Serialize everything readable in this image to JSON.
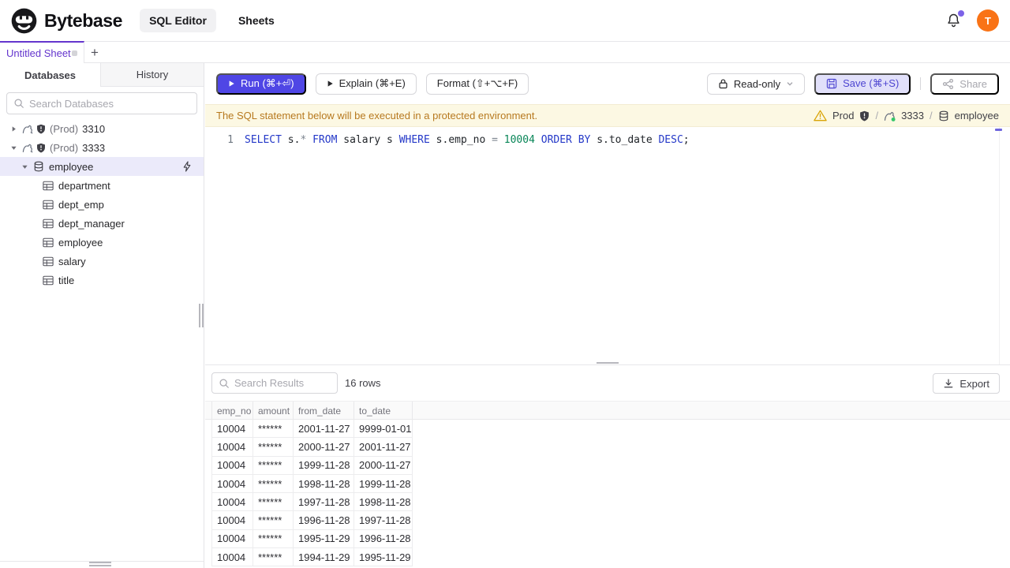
{
  "header": {
    "brand": "Bytebase",
    "nav_sql_editor": "SQL Editor",
    "nav_sheets": "Sheets",
    "avatar_text": "T"
  },
  "sheet_tabs": {
    "active_tab": "Untitled Sheet",
    "add_label": "+"
  },
  "sidebar": {
    "tab_databases": "Databases",
    "tab_history": "History",
    "search_placeholder": "Search Databases",
    "tree": {
      "instances": [
        {
          "env": "(Prod)",
          "name": "3310"
        },
        {
          "env": "(Prod)",
          "name": "3333"
        }
      ],
      "database": "employee",
      "tables": [
        "department",
        "dept_emp",
        "dept_manager",
        "employee",
        "salary",
        "title"
      ]
    }
  },
  "toolbar": {
    "run_label": "Run (⌘+⏎)",
    "explain_label": "Explain (⌘+E)",
    "format_label": "Format (⇧+⌥+F)",
    "readonly_label": "Read-only",
    "save_label": "Save (⌘+S)",
    "share_label": "Share"
  },
  "banner": {
    "message": "The SQL statement below will be executed in a protected environment.",
    "environment": "Prod",
    "instance": "3333",
    "database": "employee",
    "separator": "/"
  },
  "editor": {
    "line_number": "1",
    "sql_text": "SELECT s.* FROM salary s WHERE s.emp_no = 10004 ORDER BY s.to_date DESC;",
    "sql_tokens": [
      {
        "t": "SELECT",
        "c": "kw"
      },
      {
        "t": " s.",
        "c": "plain"
      },
      {
        "t": "*",
        "c": "op"
      },
      {
        "t": " ",
        "c": "plain"
      },
      {
        "t": "FROM",
        "c": "kw"
      },
      {
        "t": " salary s ",
        "c": "plain"
      },
      {
        "t": "WHERE",
        "c": "kw"
      },
      {
        "t": " s.emp_no ",
        "c": "plain"
      },
      {
        "t": "=",
        "c": "op"
      },
      {
        "t": " ",
        "c": "plain"
      },
      {
        "t": "10004",
        "c": "num"
      },
      {
        "t": " ",
        "c": "plain"
      },
      {
        "t": "ORDER BY",
        "c": "kw"
      },
      {
        "t": " s.to_date ",
        "c": "plain"
      },
      {
        "t": "DESC",
        "c": "kw"
      },
      {
        "t": ";",
        "c": "plain"
      }
    ]
  },
  "results": {
    "search_placeholder": "Search Results",
    "row_count": "16 rows",
    "export_label": "Export",
    "columns": [
      "emp_no",
      "amount",
      "from_date",
      "to_date"
    ],
    "rows": [
      [
        "10004",
        "******",
        "2001-11-27",
        "9999-01-01"
      ],
      [
        "10004",
        "******",
        "2000-11-27",
        "2001-11-27"
      ],
      [
        "10004",
        "******",
        "1999-11-28",
        "2000-11-27"
      ],
      [
        "10004",
        "******",
        "1998-11-28",
        "1999-11-28"
      ],
      [
        "10004",
        "******",
        "1997-11-28",
        "1998-11-28"
      ],
      [
        "10004",
        "******",
        "1996-11-28",
        "1997-11-28"
      ],
      [
        "10004",
        "******",
        "1995-11-29",
        "1996-11-28"
      ],
      [
        "10004",
        "******",
        "1994-11-29",
        "1995-11-29"
      ]
    ]
  },
  "colors": {
    "accent": "#4f46e5",
    "tab_purple": "#6435cd",
    "banner_bg": "#fcf8e3",
    "banner_text": "#b7791f",
    "avatar_bg": "#f97316",
    "keyword_blue": "#2438c8",
    "number_green": "#098658"
  }
}
